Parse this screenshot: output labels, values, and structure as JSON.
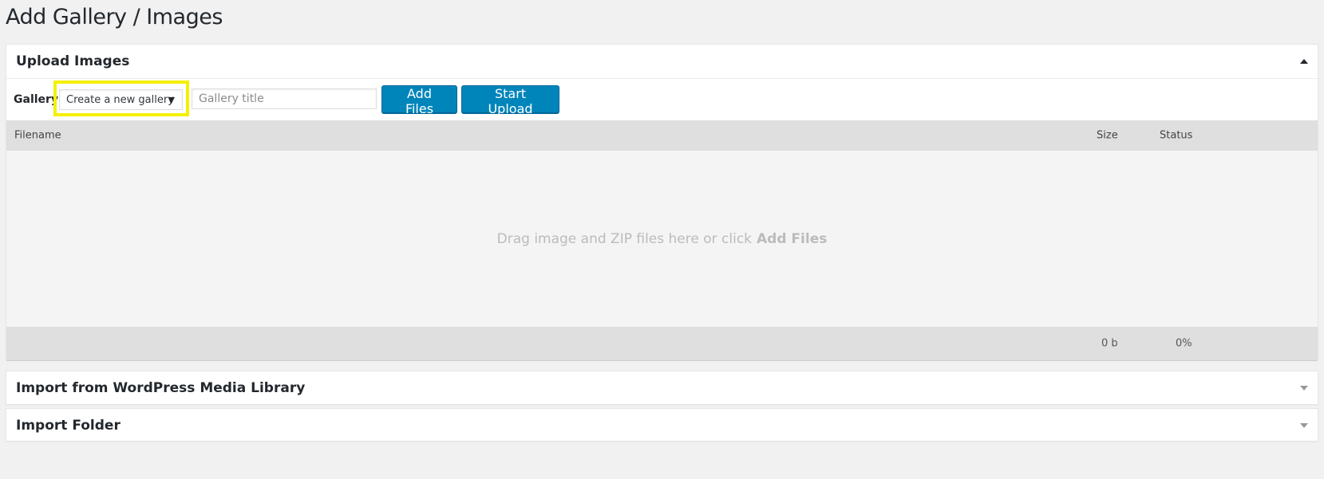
{
  "page": {
    "title": "Add Gallery / Images"
  },
  "upload_box": {
    "title": "Upload Images",
    "toggle_icon": "triangle-up-icon",
    "gallery_label": "Gallery",
    "gallery_select": {
      "selected": "Create a new gallery",
      "arrow": "▼"
    },
    "gallery_title_input": {
      "value": "",
      "placeholder": "Gallery title"
    },
    "add_files_label": "Add Files",
    "start_upload_label": "Start Upload",
    "table": {
      "columns": [
        "Filename",
        "Size",
        "Status"
      ],
      "drop_text": "Drag image and ZIP files here or click",
      "drop_text_bold": "Add Files",
      "total_size": "0 b",
      "total_percent": "0%"
    }
  },
  "media_box": {
    "title": "Import from WordPress Media Library",
    "toggle_icon": "triangle-down-icon"
  },
  "folder_box": {
    "title": "Import Folder",
    "toggle_icon": "triangle-down-icon"
  },
  "colors": {
    "button": "#0085ba",
    "highlight": "#f5f000"
  }
}
